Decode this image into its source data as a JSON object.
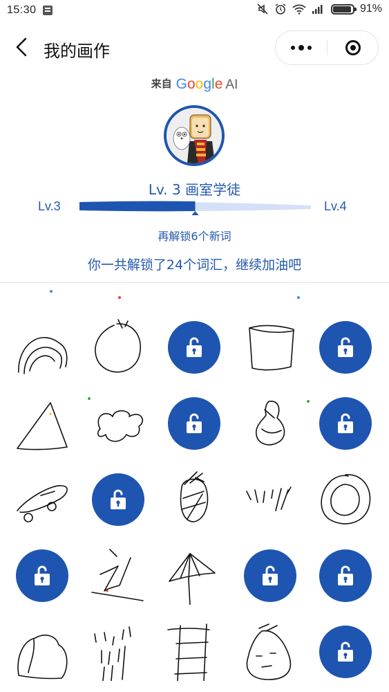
{
  "status_bar": {
    "time": "15:30",
    "battery": "91%"
  },
  "nav": {
    "title": "我的画作"
  },
  "header": {
    "from_label": "来自",
    "brand": [
      "G",
      "o",
      "o",
      "g",
      "l",
      "e"
    ],
    "brand_colors": [
      "#4285F4",
      "#EA4335",
      "#FBBC05",
      "#4285F4",
      "#34A853",
      "#EA4335"
    ],
    "ai": "AI"
  },
  "level": {
    "title": "Lv. 3 画室学徒",
    "current": "Lv.3",
    "next": "Lv.4",
    "progress": 0.5,
    "remaining": "再解锁6个新词",
    "total": "你一共解锁了24个词汇，继续加油吧"
  },
  "colors": {
    "accent": "#1e55b0",
    "progress_track": "#d4e0f7"
  },
  "grid": {
    "cells": [
      {
        "type": "doodle",
        "icon": "rainbow-doodle"
      },
      {
        "type": "doodle",
        "icon": "circle-doodle"
      },
      {
        "type": "locked",
        "icon": "lock-icon"
      },
      {
        "type": "doodle",
        "icon": "square-doodle"
      },
      {
        "type": "locked",
        "icon": "lock-icon"
      },
      {
        "type": "doodle",
        "icon": "triangle-doodle"
      },
      {
        "type": "doodle",
        "icon": "cloud-doodle"
      },
      {
        "type": "locked",
        "icon": "lock-icon"
      },
      {
        "type": "doodle",
        "icon": "vase-doodle"
      },
      {
        "type": "locked",
        "icon": "lock-icon"
      },
      {
        "type": "doodle",
        "icon": "skateboard-doodle"
      },
      {
        "type": "locked",
        "icon": "lock-icon"
      },
      {
        "type": "doodle",
        "icon": "pineapple-doodle"
      },
      {
        "type": "doodle",
        "icon": "grass-doodle"
      },
      {
        "type": "doodle",
        "icon": "ring-doodle"
      },
      {
        "type": "locked",
        "icon": "lock-icon"
      },
      {
        "type": "doodle",
        "icon": "zigzag-doodle"
      },
      {
        "type": "doodle",
        "icon": "umbrella-doodle"
      },
      {
        "type": "locked",
        "icon": "lock-icon"
      },
      {
        "type": "locked",
        "icon": "lock-icon"
      },
      {
        "type": "doodle",
        "icon": "bread-doodle"
      },
      {
        "type": "doodle",
        "icon": "rain-doodle"
      },
      {
        "type": "doodle",
        "icon": "ladder-doodle"
      },
      {
        "type": "doodle",
        "icon": "face-doodle"
      },
      {
        "type": "locked",
        "icon": "lock-icon"
      }
    ]
  }
}
